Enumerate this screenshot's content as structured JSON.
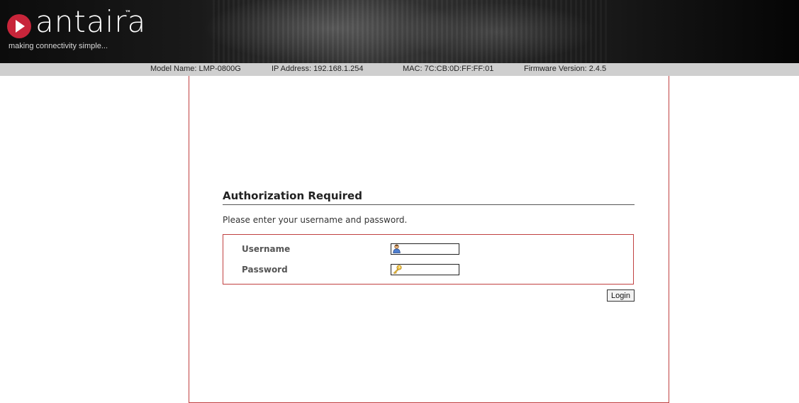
{
  "brand": {
    "name": "antaira",
    "trademark": "™",
    "tagline": "making connectivity simple..."
  },
  "infobar": {
    "model": "Model Name: LMP-0800G",
    "ip": "IP Address: 192.168.1.254",
    "mac": "MAC: 7C:CB:0D:FF:FF:01",
    "firmware": "Firmware Version: 2.4.5"
  },
  "auth": {
    "title": "Authorization Required",
    "description": "Please enter your username and password.",
    "username_label": "Username",
    "password_label": "Password",
    "username_value": "",
    "password_value": "",
    "login_label": "Login"
  },
  "colors": {
    "accent_red": "#c04040",
    "logo_red": "#c8253a",
    "infobar_bg": "#cfcfcf"
  },
  "icons": {
    "username": "user-icon",
    "password": "key-icon"
  }
}
